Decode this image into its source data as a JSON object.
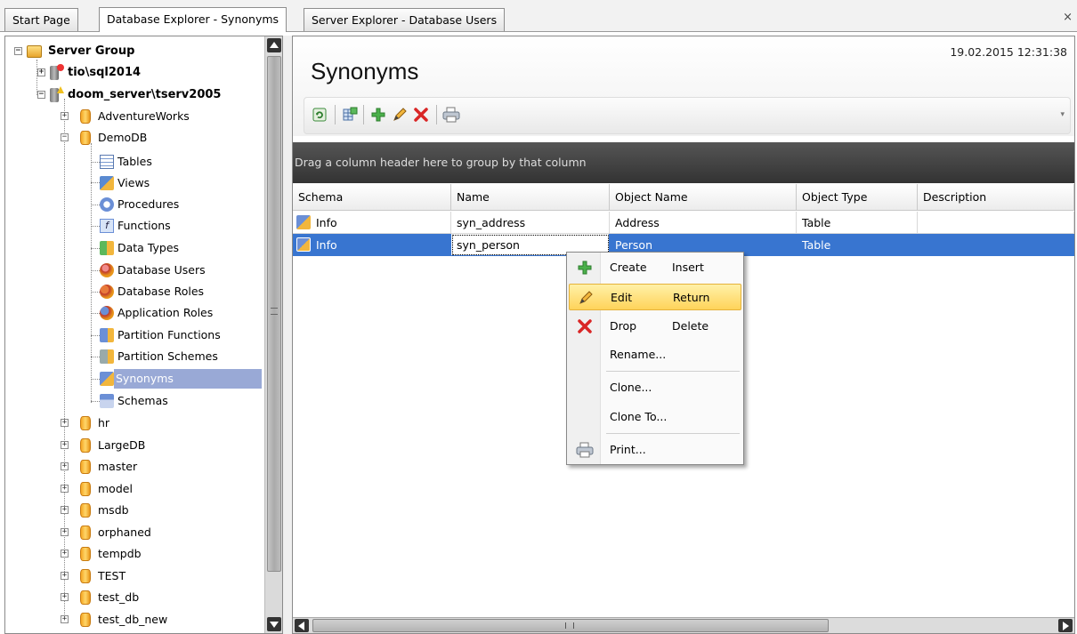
{
  "tabs": {
    "start_page": "Start Page",
    "db_explorer": "Database Explorer - Synonyms",
    "server_explorer": "Server Explorer - Database Users",
    "close_symbol": "×"
  },
  "tree": {
    "server_group": "Server Group",
    "server1": "tio\\sql2014",
    "server2": "doom_server\\tserv2005",
    "adventureworks": "AdventureWorks",
    "demodb": "DemoDB",
    "tables": "Tables",
    "views": "Views",
    "procedures": "Procedures",
    "functions": "Functions",
    "data_types": "Data Types",
    "database_users": "Database Users",
    "database_roles": "Database Roles",
    "application_roles": "Application Roles",
    "partition_functions": "Partition Functions",
    "partition_schemes": "Partition Schemes",
    "synonyms": "Synonyms",
    "schemas": "Schemas",
    "hr": "hr",
    "largedb": "LargeDB",
    "master": "master",
    "model": "model",
    "msdb": "msdb",
    "orphaned": "orphaned",
    "tempdb": "tempdb",
    "test": "TEST",
    "test_db": "test_db",
    "test_db_new": "test_db_new",
    "plus": "+",
    "minus": "−"
  },
  "main": {
    "title": "Synonyms",
    "datetime": "19.02.2015 12:31:38",
    "group_hint": "Drag a column header here to group by that column"
  },
  "grid": {
    "columns": [
      "Schema",
      "Name",
      "Object Name",
      "Object Type",
      "Description"
    ],
    "rows": [
      {
        "schema": "Info",
        "name": "syn_address",
        "object_name": "Address",
        "object_type": "Table",
        "description": ""
      },
      {
        "schema": "Info",
        "name": "syn_person",
        "object_name": "Person",
        "object_type": "Table",
        "description": ""
      }
    ]
  },
  "context_menu": {
    "create": "Create",
    "create_key": "Insert",
    "edit": "Edit",
    "edit_key": "Return",
    "drop": "Drop",
    "drop_key": "Delete",
    "rename": "Rename...",
    "clone": "Clone...",
    "clone_to": "Clone To...",
    "print": "Print..."
  },
  "colors": {
    "selection": "#3875d0",
    "tree_selection": "#99a9d6",
    "menu_highlight": "#ffd35a"
  }
}
